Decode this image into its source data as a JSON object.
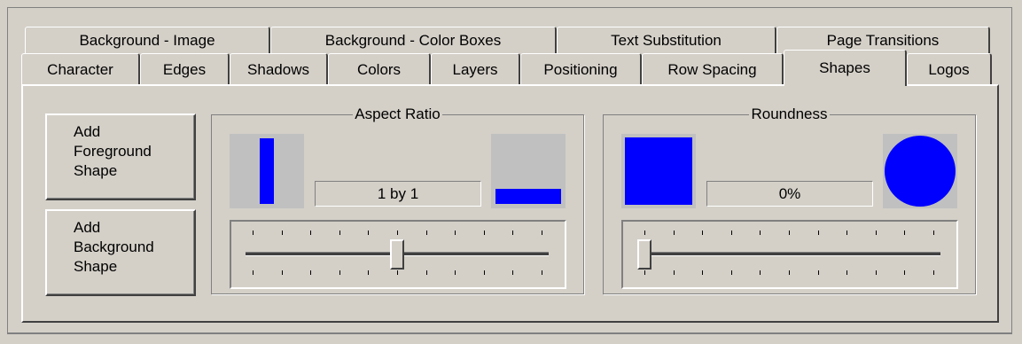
{
  "tabs": {
    "row1": [
      "Background - Image",
      "Background - Color Boxes",
      "Text Substitution",
      "Page Transitions"
    ],
    "row2": [
      "Character",
      "Edges",
      "Shadows",
      "Colors",
      "Layers",
      "Positioning",
      "Row Spacing",
      "Shapes",
      "Logos"
    ],
    "active": "Shapes"
  },
  "buttons": {
    "add_foreground": "Add\nForeground\nShape",
    "add_background": "Add\nBackground\nShape"
  },
  "aspect_ratio": {
    "title": "Aspect Ratio",
    "value": "1 by 1",
    "slider_position": 0.5,
    "tick_count": 11
  },
  "roundness": {
    "title": "Roundness",
    "value": "0%",
    "slider_position": 0.0,
    "tick_count": 11
  },
  "colors": {
    "shape": "#0000ff",
    "preview_bg": "#c0c0c0"
  }
}
